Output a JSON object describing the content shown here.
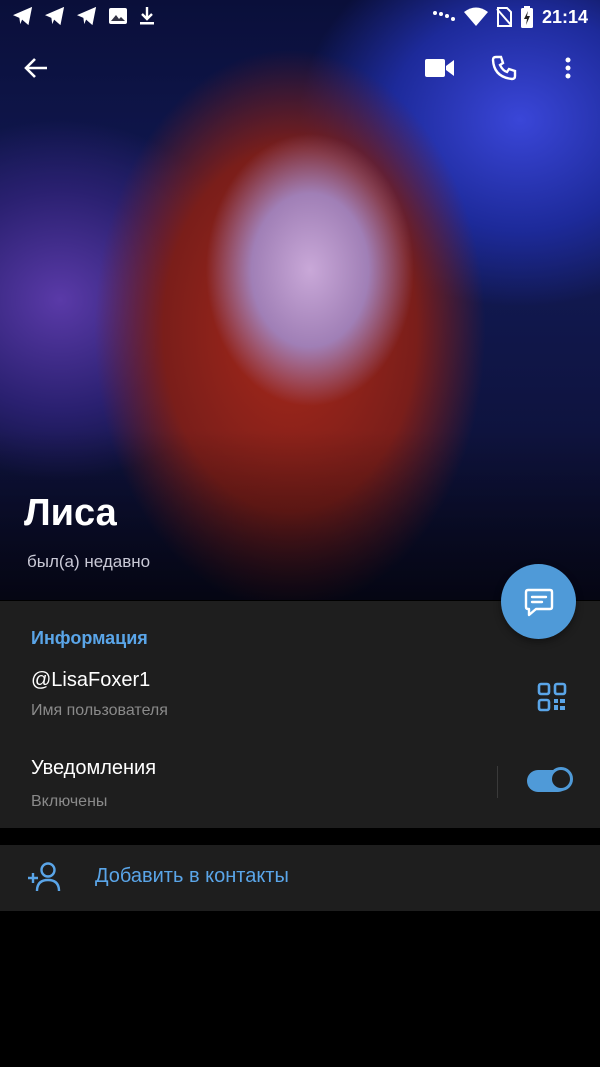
{
  "status_bar": {
    "time": "21:14",
    "left_icons": [
      "telegram-icon",
      "telegram-icon",
      "telegram-icon",
      "image-icon",
      "download-icon"
    ],
    "right_icons": [
      "dnd-icon",
      "wifi-icon",
      "no-sim-icon",
      "battery-charging-icon"
    ]
  },
  "toolbar": {
    "back_icon": "arrow-left-icon",
    "video_call_icon": "video-camera-icon",
    "call_icon": "phone-icon",
    "menu_icon": "more-vertical-icon"
  },
  "profile": {
    "name": "Лиса",
    "last_seen": "был(а) недавно",
    "message_fab_icon": "chat-icon"
  },
  "info": {
    "section_title": "Информация",
    "username": "@LisaFoxer1",
    "username_label": "Имя пользователя",
    "qr_icon": "qr-code-icon",
    "notifications_title": "Уведомления",
    "notifications_state": "Включены",
    "notifications_enabled": true
  },
  "actions": {
    "add_contact_icon": "add-person-icon",
    "add_contact_label": "Добавить в контакты"
  },
  "colors": {
    "accent": "#5aa5e8",
    "fab": "#4f9ad8",
    "card_bg": "#1e1e1e",
    "page_bg": "#000000",
    "secondary_text": "#8a8a8a"
  }
}
